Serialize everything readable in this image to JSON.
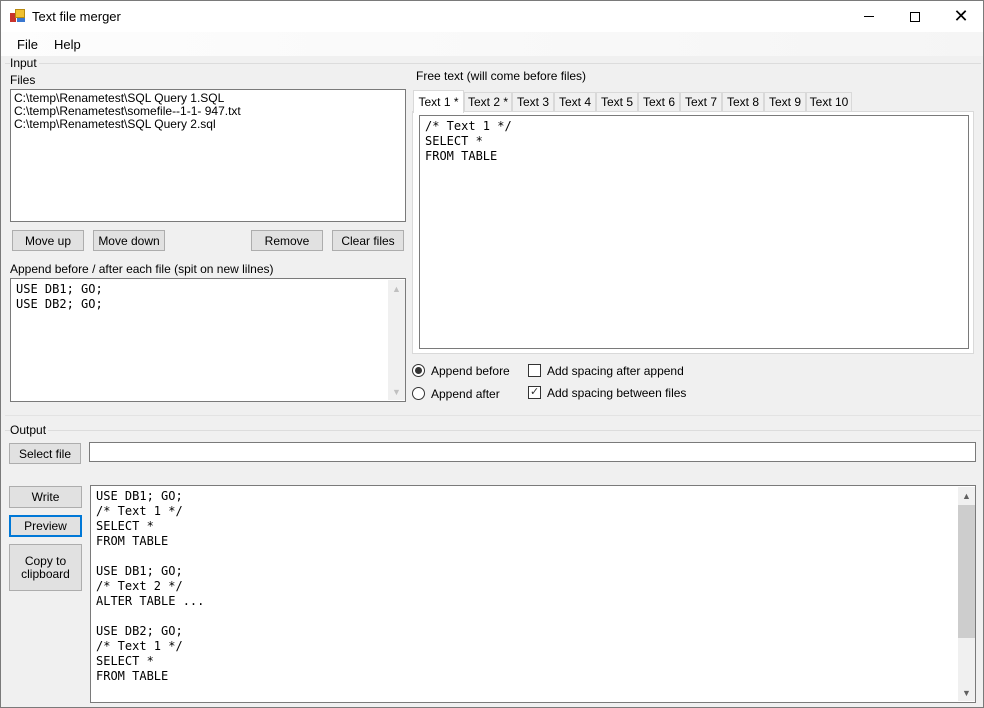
{
  "window": {
    "title": "Text file merger",
    "icon": "app-icon",
    "controls": {
      "minimize": "minimize-icon",
      "maximize": "maximize-icon",
      "close": "close-icon"
    }
  },
  "menu": {
    "items": [
      "File",
      "Help"
    ]
  },
  "input": {
    "group_label": "Input",
    "files_label": "Files",
    "files": [
      "C:\\temp\\Renametest\\SQL Query 1.SQL",
      "C:\\temp\\Renametest\\somefile--1-1- 947.txt",
      "C:\\temp\\Renametest\\SQL Query 2.sql"
    ],
    "buttons": {
      "move_up": "Move up",
      "move_down": "Move down",
      "remove": "Remove",
      "clear_files": "Clear files"
    },
    "append_label": "Append before / after each file (spit on new lilnes)",
    "append_lines": [
      "USE DB1; GO;",
      "USE DB2; GO;"
    ]
  },
  "free_text": {
    "label": "Free text (will come before files)",
    "tabs": [
      "Text 1 *",
      "Text 2 *",
      "Text 3",
      "Text 4",
      "Text 5",
      "Text 6",
      "Text 7",
      "Text 8",
      "Text 9",
      "Text 10"
    ],
    "active_tab": "Text 1 *",
    "content_lines": [
      "/* Text 1 */",
      "SELECT *",
      "FROM TABLE"
    ]
  },
  "options": {
    "append_before": {
      "label": "Append before",
      "checked": true
    },
    "append_after": {
      "label": "Append after",
      "checked": false
    },
    "spacing_after_append": {
      "label": "Add spacing after append",
      "checked": false
    },
    "spacing_between_files": {
      "label": "Add spacing between files",
      "checked": true
    }
  },
  "output": {
    "group_label": "Output",
    "select_file_label": "Select file",
    "file_path_value": "",
    "buttons": {
      "write": "Write",
      "preview": "Preview",
      "copy_line1": "Copy to",
      "copy_line2": "clipboard"
    },
    "preview_lines": [
      "USE DB1; GO;",
      "/* Text 1 */",
      "SELECT *",
      "FROM TABLE",
      "",
      "USE DB1; GO;",
      "/* Text 2 */",
      "ALTER TABLE ...",
      "",
      "USE DB2; GO;",
      "/* Text 1 */",
      "SELECT *",
      "FROM TABLE"
    ]
  },
  "colors": {
    "focus_accent": "#0078d7",
    "window_bg": "#f0f0f0",
    "button_bg": "#e1e1e1"
  }
}
